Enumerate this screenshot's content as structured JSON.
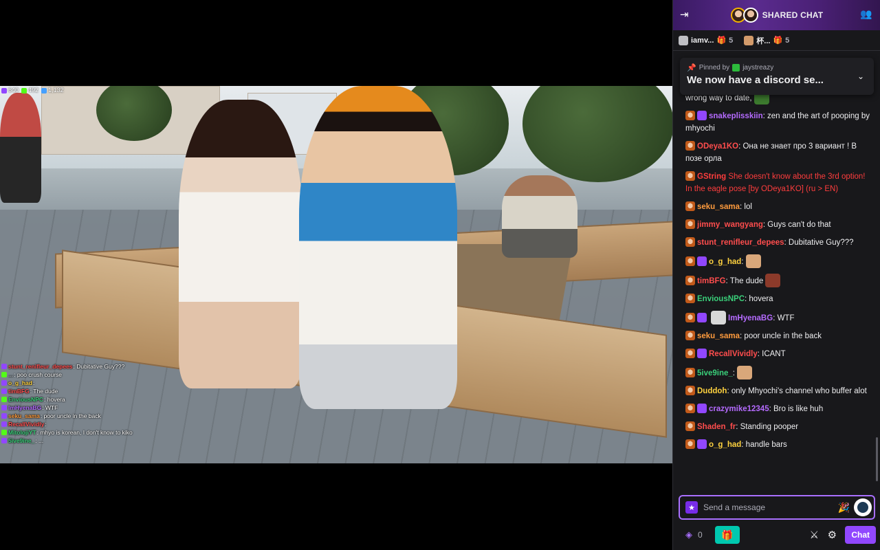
{
  "header": {
    "title": "SHARED CHAT",
    "collapse_icon": "collapse-right-icon",
    "users_icon": "users-icon"
  },
  "channels": [
    {
      "name": "iamv...",
      "gift_count": "5"
    },
    {
      "name": "杯...",
      "gift_count": "5"
    }
  ],
  "pinned": {
    "label": "Pinned by",
    "user": "jaystreazy",
    "text": "We now have a discord se..."
  },
  "video_stats": {
    "viewers_a": "640",
    "viewers_b": "492",
    "viewers_c": "1,132"
  },
  "overlay_chat": [
    {
      "user": "stunt_renifleur_depees",
      "text": ": Dubitative Guy???",
      "color": "#ff4d4d"
    },
    {
      "user": "... ",
      "text": ": poo crush course",
      "color": "#9aa0a6"
    },
    {
      "user": "o_g_had",
      "text": ":",
      "color": "#ffd23f"
    },
    {
      "user": "timBFG",
      "text": ": The dude",
      "color": "#ff4d4d"
    },
    {
      "user": "EnviousNPC",
      "text": ": hovera",
      "color": "#3ad07a"
    },
    {
      "user": "ImHyenaBG",
      "text": ": WTF",
      "color": "#b56bff"
    },
    {
      "user": "seku_sama",
      "text": ": poor uncle in the back",
      "color": "#ff9b3d"
    },
    {
      "user": "RecallVividly",
      "text": ": ",
      "color": "#ff4d4d"
    },
    {
      "user": "MitolojiYT",
      "text": ": mhyo is korean, I don't know to kiko",
      "color": "#3ad07a"
    },
    {
      "user": "5ive9ine_",
      "text": ": ...",
      "color": "#3ad07a"
    }
  ],
  "messages": [
    {
      "user": "",
      "color": "#efeff1",
      "text": "wrong way to date,",
      "emote": true,
      "partial": true
    },
    {
      "user": "snakeplisskiin",
      "color": "#b56bff",
      "text": ": zen and the art of pooping by mhyochi"
    },
    {
      "user": "ODeya1KO",
      "color": "#ff4d4d",
      "text": ": Она не знает про 3 вариант ! В позе орла"
    },
    {
      "user": "GString",
      "color": "#ff3d3d",
      "text": " She doesn't know about the 3rd option! In the eagle pose",
      "translation": " [by ODeya1KO] (ru > EN)",
      "red": true
    },
    {
      "user": "seku_sama",
      "color": "#ff9b3d",
      "text": ": lol"
    },
    {
      "user": "jimmy_wangyang",
      "color": "#ff4d4d",
      "text": ": Guys can't do that"
    },
    {
      "user": "stunt_renifleur_depees",
      "color": "#ff4d4d",
      "text": ": Dubitative Guy???"
    },
    {
      "user": "o_g_had",
      "color": "#ffd23f",
      "text": ":",
      "emote": true
    },
    {
      "user": "timBFG",
      "color": "#ff4d4d",
      "text": ": The dude",
      "emote": true
    },
    {
      "user": "EnviousNPC",
      "color": "#3ad07a",
      "text": ": hovera"
    },
    {
      "user": "ImHyenaBG",
      "color": "#b56bff",
      "text": ": WTF",
      "emote_before": true
    },
    {
      "user": "seku_sama",
      "color": "#ff9b3d",
      "text": ": poor uncle in the back"
    },
    {
      "user": "RecallVividly",
      "color": "#ff4d4d",
      "text": ": ICANT"
    },
    {
      "user": "5ive9ine_",
      "color": "#3ad07a",
      "text": ":",
      "emote": true
    },
    {
      "user": "Duddoh",
      "color": "#ffd23f",
      "text": ": only Mhyochi's channel who buffer alot"
    },
    {
      "user": "crazymike12345",
      "color": "#b56bff",
      "text": ": Bro is like huh"
    },
    {
      "user": "Shaden_fr",
      "color": "#ff4d4d",
      "text": ": Standing pooper"
    },
    {
      "user": "o_g_had",
      "color": "#ffd23f",
      "text": ": handle bars"
    }
  ],
  "input": {
    "placeholder": "Send a message"
  },
  "bottom": {
    "points": "0",
    "chat_button": "Chat"
  },
  "colors": {
    "accent": "#9147ff",
    "panel_bg": "#18181b",
    "gift_teal": "#00c8af"
  }
}
